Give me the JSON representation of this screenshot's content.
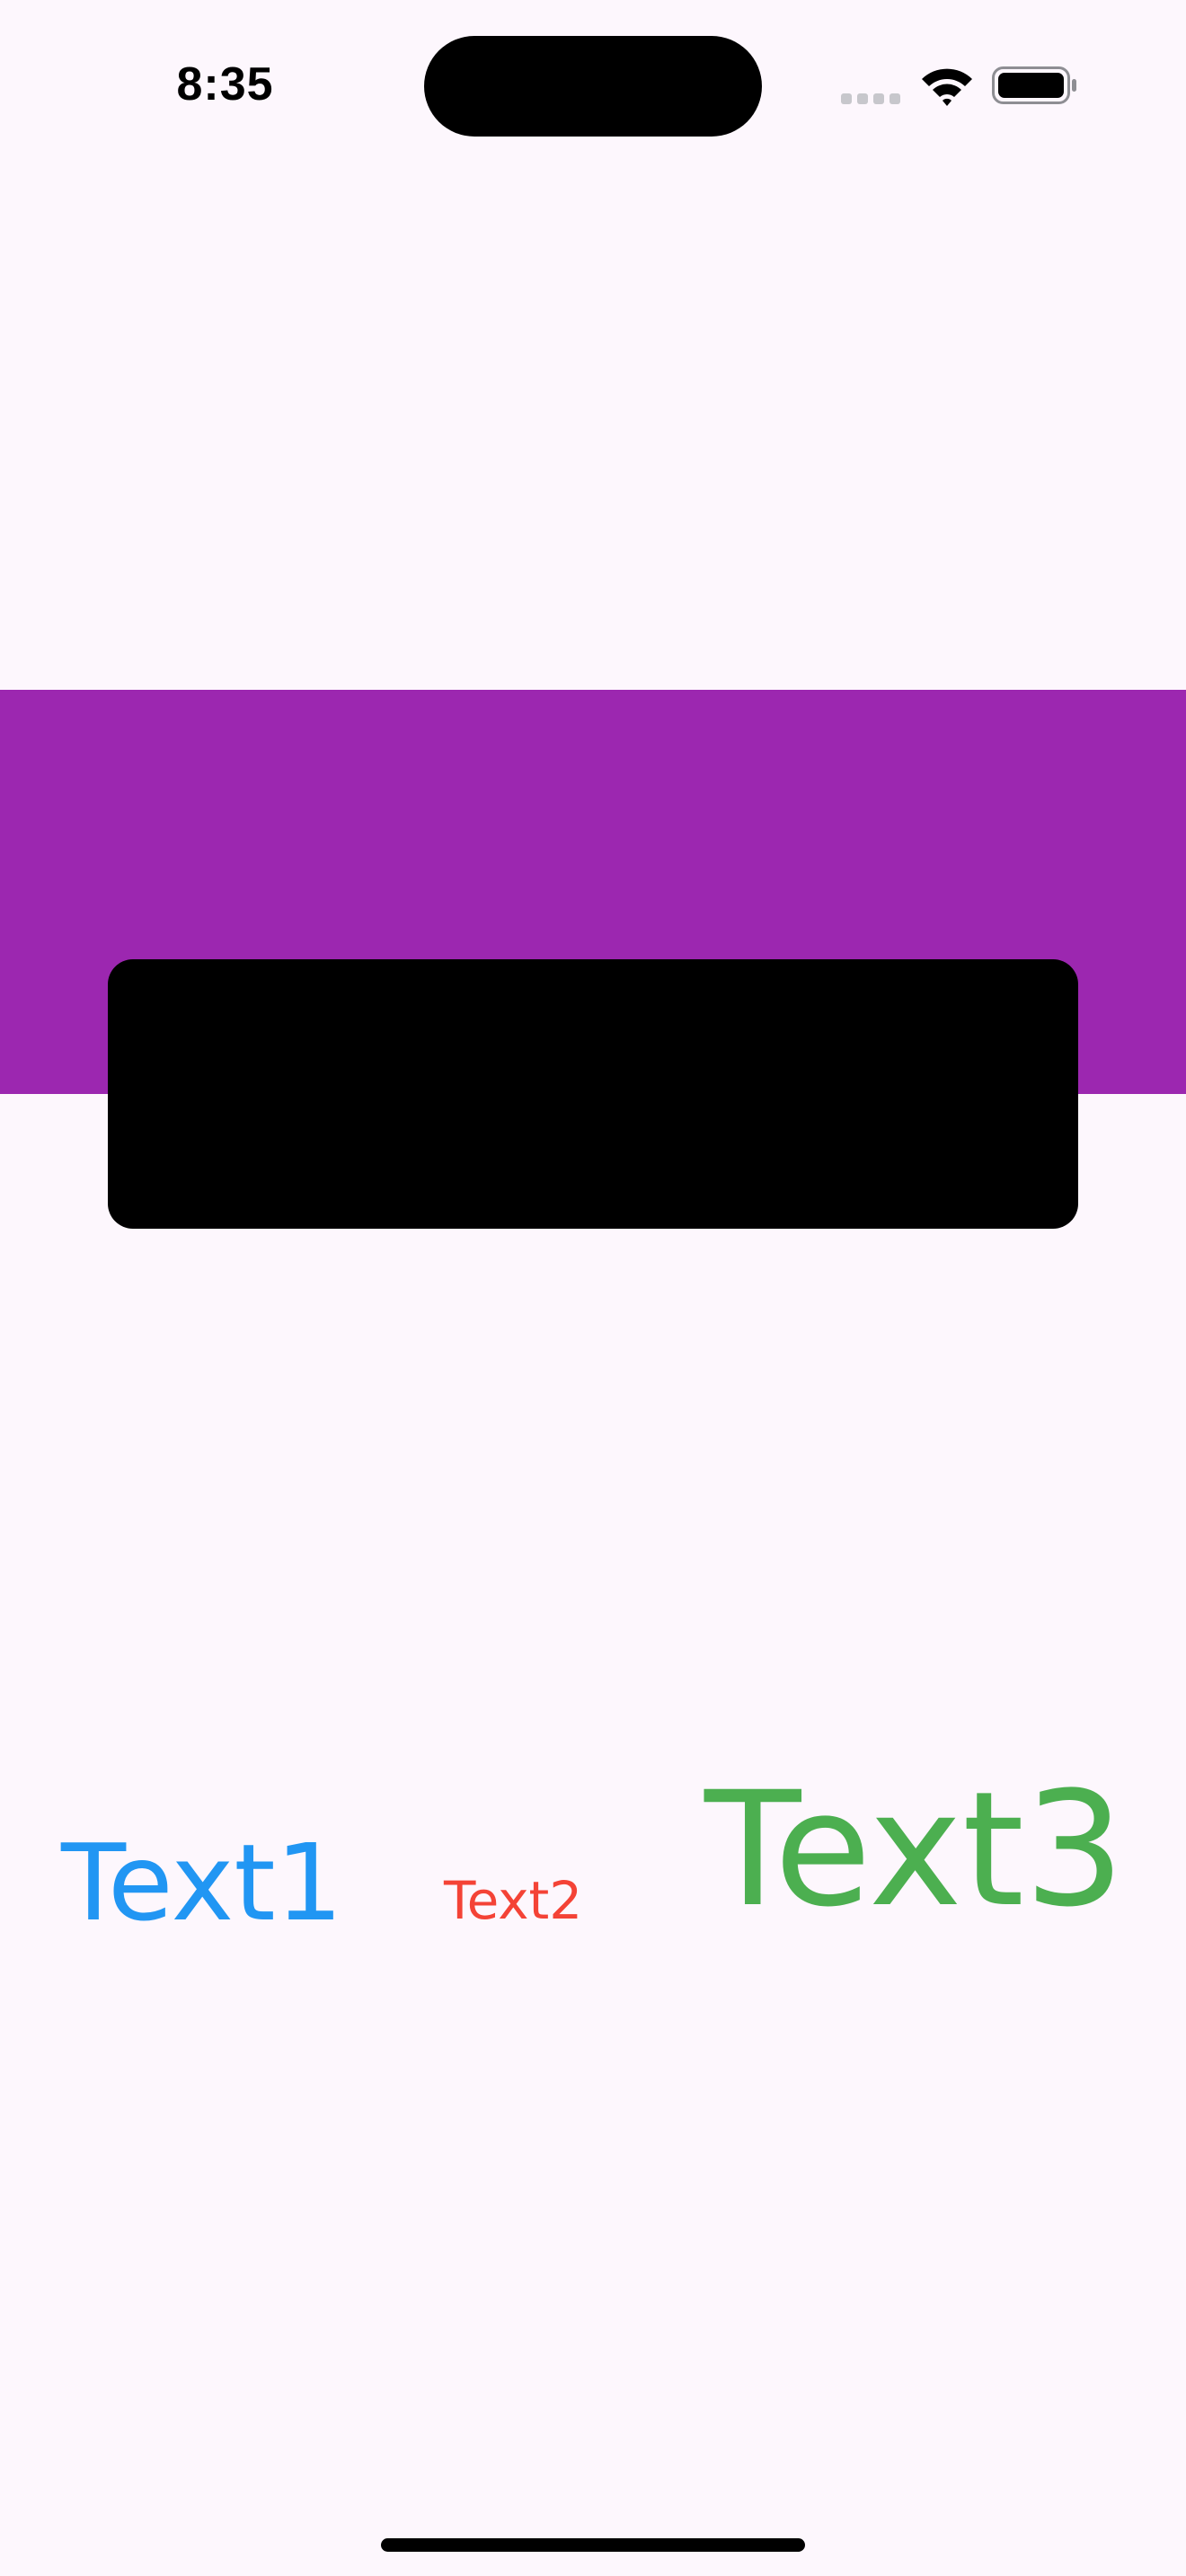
{
  "status_bar": {
    "time": "8:35",
    "icons": [
      "cellular-signal-icon",
      "wifi-icon",
      "battery-icon"
    ]
  },
  "colors": {
    "background": "#FDF7FD",
    "band": "#9C27B0",
    "card": "#000000",
    "text1": "#2196F3",
    "text2": "#F44336",
    "text3": "#4CAF50"
  },
  "texts": {
    "text1": "Text1",
    "text2": "Text2",
    "text3": "Text3"
  }
}
